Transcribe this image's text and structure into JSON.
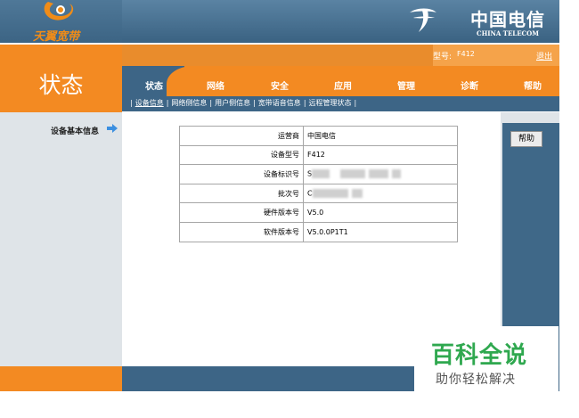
{
  "header": {
    "logo_text": "天翼宽带",
    "brand_cn": "中国电信",
    "brand_en": "CHINA TELECOM"
  },
  "page_title": "状态",
  "model": {
    "label": "型号:",
    "value": "F412",
    "logout": "退出"
  },
  "tabs": [
    {
      "label": "状态"
    },
    {
      "label": "网络"
    },
    {
      "label": "安全"
    },
    {
      "label": "应用"
    },
    {
      "label": "管理"
    },
    {
      "label": "诊断"
    },
    {
      "label": "帮助"
    }
  ],
  "subnav": [
    "设备信息",
    "网络侧信息",
    "用户侧信息",
    "宽带语音信息",
    "远程管理状态"
  ],
  "sidebar": {
    "item": "设备基本信息"
  },
  "help_button": "帮助",
  "info_table": [
    {
      "key": "运营商",
      "value": "中国电信"
    },
    {
      "key": "设备型号",
      "value": "F412"
    },
    {
      "key": "设备标识号",
      "value": "S"
    },
    {
      "key": "批次号",
      "value": "C"
    },
    {
      "key": "硬件版本号",
      "value": "V5.0"
    },
    {
      "key": "软件版本号",
      "value": "V5.0.0P1T1"
    }
  ],
  "watermark": {
    "title": "百科全说",
    "subtitle": "助你轻松解决"
  },
  "colors": {
    "orange": "#f38a22",
    "blue": "#3d6586",
    "gray": "#dfe4e8",
    "watermark_green": "#2fa84f"
  }
}
